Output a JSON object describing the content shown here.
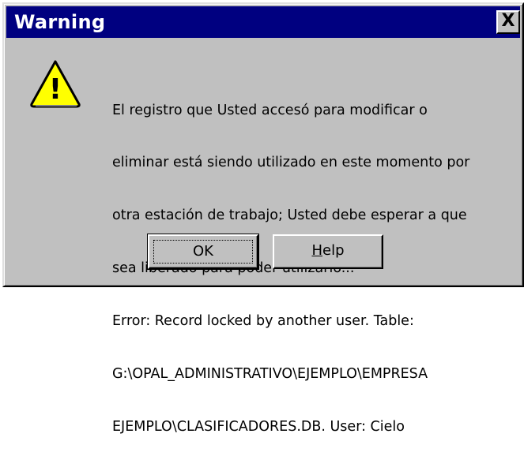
{
  "window": {
    "title": "Warning",
    "close_glyph": "X"
  },
  "icon": {
    "name": "warning-icon",
    "glyph": "!",
    "fill": "#ffff00"
  },
  "message": {
    "lines": [
      "El registro que Usted accesó para modificar o",
      "eliminar está siendo utilizado en este momento por",
      "otra estación de trabajo; Usted debe esperar a que",
      "sea liberado para poder utilizarlo...",
      "Error: Record locked by another user. Table:",
      "G:\\OPAL_ADMINISTRATIVO\\EJEMPLO\\EMPRESA",
      "EJEMPLO\\CLASIFICADORES.DB. User: Cielo"
    ]
  },
  "buttons": {
    "ok_label": "OK",
    "help_mnemonic": "H",
    "help_rest": "elp"
  },
  "colors": {
    "face": "#c0c0c0",
    "titlebar": "#000080",
    "title_text": "#ffffff"
  }
}
